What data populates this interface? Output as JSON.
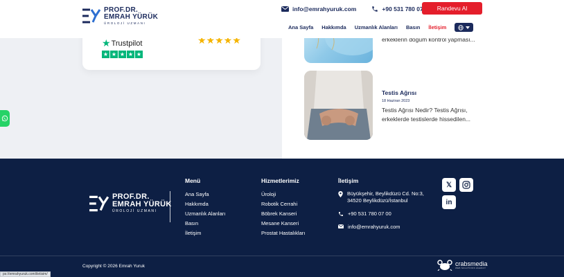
{
  "header": {
    "logo": {
      "line1": "PROF.DR.",
      "line2": "EMRAH YÜRÜK",
      "line3": "ÜROLOJİ UZMANI"
    },
    "email": "info@emrahyuruk.com",
    "phone": "+90 531 780 07 00",
    "appointment_label": "Randevu Al",
    "nav": [
      {
        "label": "Ana Sayfa",
        "active": false
      },
      {
        "label": "Hakkımda",
        "active": false
      },
      {
        "label": "Uzmanlık Alanları",
        "active": false
      },
      {
        "label": "Basın",
        "active": false
      },
      {
        "label": "İletişim",
        "active": true
      }
    ]
  },
  "review": {
    "brand": "Trustpilot",
    "stars": "★★★★★",
    "rating_stars": 5
  },
  "blog": {
    "item1": {
      "excerpt_tail": "erkeklerin doğum kontrol yapması..."
    },
    "item2": {
      "title": "Testis Ağrısı",
      "date": "18 Haziran 2023",
      "excerpt": "Testis Ağrısı Nedir? Testis Ağrısı, erkeklerde testislerde hissedilen..."
    }
  },
  "footer": {
    "logo": {
      "line1": "PROF.DR.",
      "line2": "EMRAH YÜRÜK",
      "line3": "ÜROLOJİ UZMANI"
    },
    "menu": {
      "title": "Menü",
      "items": [
        "Ana Sayfa",
        "Hakkımda",
        "Uzmanlık Alanları",
        "Basın",
        "İletişim"
      ]
    },
    "services": {
      "title": "Hizmetlerimiz",
      "items": [
        "Üroloji",
        "Robotik Cerrahi",
        "Böbrek Kanseri",
        "Mesane Kanseri",
        "Prostat Hastalıkları"
      ]
    },
    "contact": {
      "title": "İletişim",
      "address_line1": "Büyükşehir, Beylikdüzü Cd. No:3,",
      "address_line2": "34520 Beylikdüzü/İstanbul",
      "phone": "+90 531 780 07 00",
      "email": "info@emrahyuruk.com"
    },
    "social": {
      "x": "𝕏",
      "instagram": "instagram-icon",
      "linkedin": "in"
    },
    "copyright": "Copyright © 2026 Emrah Yuruk",
    "agency": {
      "name": "crabsmedia",
      "tagline": "WEB SOLUTIONS AGENCY"
    }
  },
  "status_url": "ps://emrahyuruk.com/iletisim/",
  "colors": {
    "navy": "#1b2a5c",
    "footer_bg": "#0d1f44",
    "accent_red": "#e41e2b",
    "trustpilot_green": "#00b67a",
    "star_gold": "#f5b400",
    "whatsapp_green": "#25d366"
  }
}
